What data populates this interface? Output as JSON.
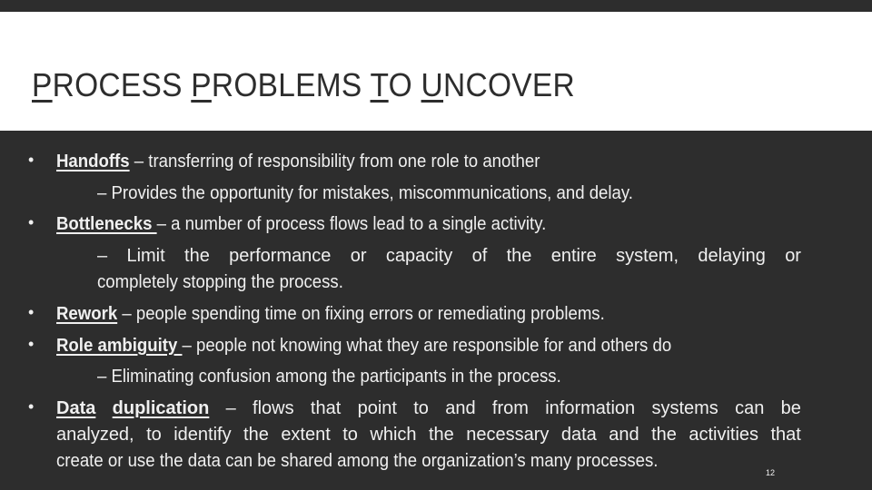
{
  "slide": {
    "title_parts": [
      {
        "text": "P",
        "underline": true
      },
      {
        "text": "ROCESS ",
        "underline": false
      },
      {
        "text": "P",
        "underline": true
      },
      {
        "text": "ROBLEMS ",
        "underline": false
      },
      {
        "text": "T",
        "underline": true
      },
      {
        "text": "O ",
        "underline": false
      },
      {
        "text": "U",
        "underline": true
      },
      {
        "text": "NCOVER",
        "underline": false
      }
    ],
    "bullets": [
      {
        "term": "Handoffs",
        "text": " – transferring of responsibility from one role to another",
        "sub": "– Provides the opportunity for mistakes, miscommunications, and delay."
      },
      {
        "term": "Bottlenecks ",
        "text": " – a number of process flows lead to a single activity.",
        "sub_words": [
          "–",
          "Limit",
          "the",
          "performance",
          "or",
          "capacity",
          "of",
          "the",
          "entire",
          "system,",
          "delaying",
          "or"
        ],
        "sub_cont": "completely stopping the process."
      },
      {
        "term": "Rework",
        "text": " – people spending time on fixing errors or remediating problems."
      },
      {
        "term": "Role ambiguity ",
        "text": " – people not knowing what they are responsible for and others do",
        "sub": "– Eliminating confusion among the participants in the process."
      },
      {
        "term1": "Data",
        "term2": "duplication ",
        "line1_words": [
          "–",
          "flows",
          "that",
          "point",
          "to",
          "and",
          "from",
          "information",
          "systems",
          "can",
          "be"
        ],
        "line2_words": [
          "analyzed,",
          "to",
          "identify",
          "the",
          "extent",
          "to",
          "which",
          "the",
          "necessary",
          "data",
          "and",
          "the",
          "activities",
          "that"
        ],
        "line3": "create or use the data can be shared among the organization’s many processes."
      }
    ],
    "page_number": "12",
    "colors": {
      "background": "#2d2d2d",
      "title_band": "#ffffff",
      "text": "#f0f0f0"
    }
  }
}
